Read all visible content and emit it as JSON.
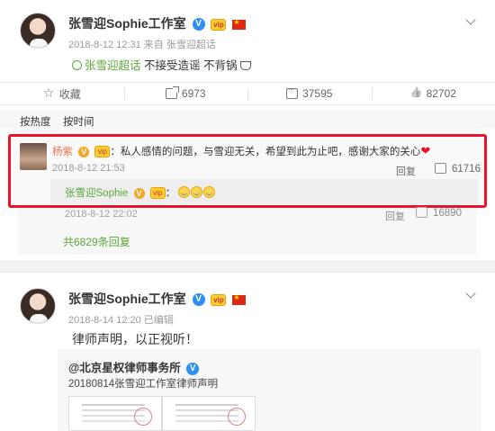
{
  "post1": {
    "author": "张雪迎Sophie工作室",
    "meta": "2018-8-12 12:31 来自 张雪迎超话",
    "topic_link": "张雪迎超话",
    "topic_text": " 不接受造谣 不背锅",
    "actions": {
      "favorite": "收藏",
      "share_count": "6973",
      "comment_count": "37595",
      "like_count": "82702"
    },
    "sort_tabs": [
      "按热度",
      "按时间"
    ],
    "top_comment": {
      "author": "杨紫",
      "text": "：私人感情的问题，与雪迎无关，希望到此为止吧，感谢大家的关心",
      "time": "2018-8-12 21:53",
      "reply_label": "回复",
      "likes": "61716"
    },
    "sub_reply": {
      "author": "张雪迎Sophie",
      "text": "："
    },
    "second_comment": {
      "time": "2018-8-12 22:02",
      "reply_label": "回复",
      "likes": "16890"
    },
    "more_replies": "共6829条回复"
  },
  "post2": {
    "author": "张雪迎Sophie工作室",
    "meta": "2018-8-14 12:20 已编辑",
    "body": "律师声明，以正视听！",
    "quote_author": "@北京星权律师事务所",
    "quote_text": "20180814张雪迎工作室律师声明"
  },
  "colors": {
    "highlight_border": "#e8142b",
    "topic_green": "#5aa63a",
    "commenter_orange": "#eb7350",
    "verified_blue": "#2e8ff0"
  }
}
